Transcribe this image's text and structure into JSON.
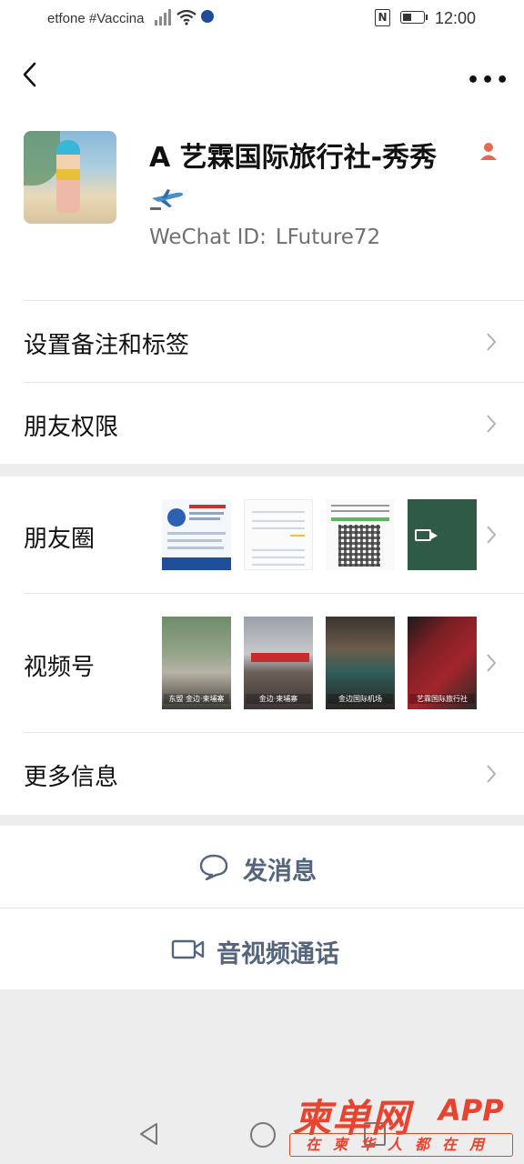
{
  "status_bar": {
    "carrier_text": "etfone #Vaccina",
    "time": "12:00",
    "icons": [
      "signal-icon",
      "wifi-icon",
      "vpn-icon",
      "nfc-icon",
      "battery-icon"
    ]
  },
  "nav": {
    "back_icon": "chevron-left-icon",
    "more_icon": "more-dots-icon"
  },
  "profile": {
    "name": "A 艺霖国际旅行社-秀秀",
    "name_suffix_icon": "person-icon",
    "extra_icon": "airplane-icon",
    "wechat_id_label": "WeChat ID:",
    "wechat_id_value": "LFuture72"
  },
  "menu": {
    "remark_tags": "设置备注和标签",
    "friend_permissions": "朋友权限",
    "moments": "朋友圈",
    "channels": "视频号",
    "more_info": "更多信息"
  },
  "moments_thumbs": [
    {
      "kind": "document"
    },
    {
      "kind": "document"
    },
    {
      "kind": "qr-code"
    },
    {
      "kind": "video"
    }
  ],
  "channels_thumbs": [
    {
      "caption": "东盟 金边·柬埔寨"
    },
    {
      "caption": "金边·柬埔寨"
    },
    {
      "caption": "金边国际机场"
    },
    {
      "caption": "艺霖国际旅行社"
    }
  ],
  "actions": {
    "send_message": "发消息",
    "voice_video_call": "音视频通话"
  },
  "watermark": {
    "main": "柬单网",
    "app": "APP",
    "slogan": "在柬华人都在用"
  },
  "colors": {
    "action_text": "#55657e",
    "watermark": "#e8432f",
    "background": "#ededed"
  }
}
